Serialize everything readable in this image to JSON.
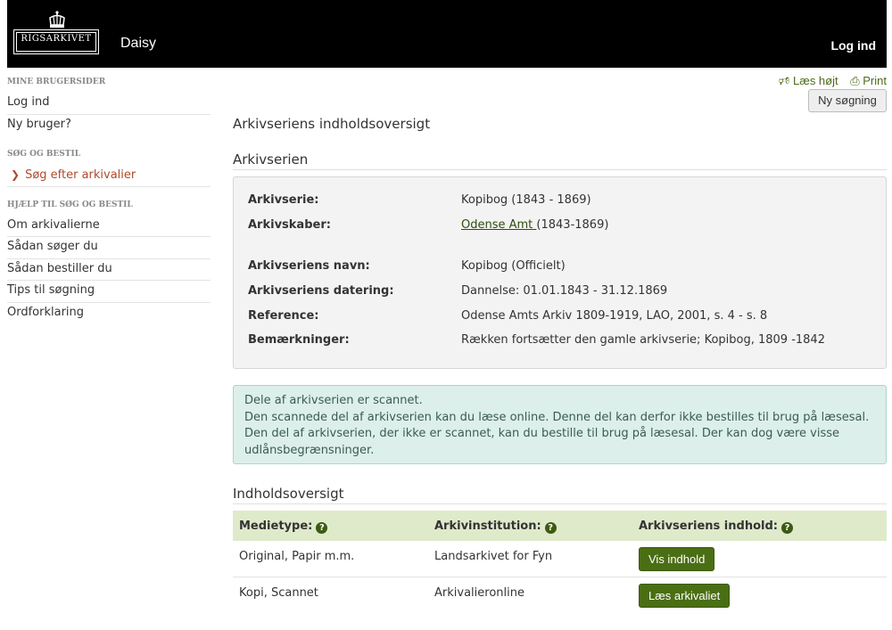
{
  "header": {
    "logo_text": "RIGSARKIVET",
    "app_name": "Daisy",
    "login": "Log ind"
  },
  "sidebar": {
    "section1": {
      "heading": "MINE BRUGERSIDER",
      "items": [
        "Log ind",
        "Ny bruger?"
      ]
    },
    "section2": {
      "heading": "SØG OG BESTIL",
      "items": [
        "Søg efter arkivalier"
      ]
    },
    "section3": {
      "heading": "HJÆLP TIL SØG OG BESTIL",
      "items": [
        "Om arkivalierne",
        "Sådan søger du",
        "Sådan bestiller du",
        "Tips til søgning",
        "Ordforklaring"
      ]
    }
  },
  "tools": {
    "read_aloud": "Læs højt",
    "print": "Print",
    "new_search": "Ny søgning"
  },
  "main": {
    "page_title": "Arkivseriens indholdsoversigt",
    "section_title": "Arkivserien",
    "info": {
      "series_label": "Arkivserie:",
      "series_value": "Kopibog (1843 - 1869)",
      "creator_label": "Arkivskaber:",
      "creator_link": "Odense Amt ",
      "creator_years": "(1843-1869)",
      "name_label": "Arkivseriens navn:",
      "name_value": "Kopibog (Officielt)",
      "dating_label": "Arkivseriens datering:",
      "dating_value": "Dannelse: 01.01.1843 - 31.12.1869",
      "reference_label": "Reference:",
      "reference_value": "Odense Amts Arkiv 1809-1919, LAO, 2001, s. 4 - s. 8",
      "remarks_label": "Bemærkninger:",
      "remarks_value": "Rækken fortsætter den gamle arkivserie; Kopibog, 1809 -1842"
    },
    "alert": {
      "line1": "Dele af arkivserien er scannet.",
      "line2": "Den scannede del af arkivserien kan du læse online. Denne del kan derfor ikke bestilles til brug på læsesal. Den del af arkivserien, der ikke er scannet, kan du bestille til brug på læsesal. Der kan dog være visse udlånsbegrænsninger."
    },
    "toc": {
      "title": "Indholdsoversigt",
      "headers": [
        "Medietype:",
        "Arkivinstitution:",
        "Arkivseriens indhold:"
      ],
      "rows": [
        {
          "media": "Original, Papir m.m.",
          "institution": "Landsarkivet for Fyn",
          "button": "Vis indhold"
        },
        {
          "media": "Kopi, Scannet",
          "institution": "Arkivalieronline",
          "button": "Læs arkivaliet"
        }
      ]
    }
  },
  "colors": {
    "header_bg": "#000000",
    "accent_green": "#4a6e14",
    "active_link": "#b04a2a",
    "alert_bg": "#dcefea",
    "table_head_bg": "#dfeacb"
  }
}
